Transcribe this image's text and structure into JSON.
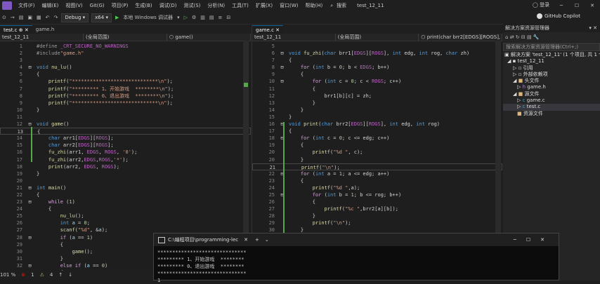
{
  "menubar": {
    "items": [
      "文件(F)",
      "编辑(E)",
      "视图(V)",
      "Git(G)",
      "项目(P)",
      "生成(B)",
      "调试(D)",
      "测试(S)",
      "分析(N)",
      "工具(T)",
      "扩展(X)",
      "窗口(W)",
      "帮助(H)"
    ],
    "search_label": "搜索",
    "window_title": "test_12_11",
    "login_label": "登录"
  },
  "toolbar": {
    "config": "Debug",
    "platform": "x64",
    "run_label": "本地 Windows 调试器",
    "copilot_label": "GitHub Copilot"
  },
  "left_editor": {
    "tabs": [
      "test.c",
      "game.h"
    ],
    "nav_project": "test_12_11",
    "nav_scope": "(全局范围)",
    "nav_function": "game()",
    "zoom": "101 %",
    "status_errors": "1",
    "status_warnings": "4"
  },
  "right_editor": {
    "tabs": [
      "game.c"
    ],
    "nav_project": "test_12_11",
    "nav_scope": "(全局范围)",
    "nav_function": "print(char brr2[EDGS][ROGS], int e"
  },
  "solution_explorer": {
    "header": "解决方案资源管理器",
    "search_placeholder": "搜索解决方案资源管理器(Ctrl+;)",
    "tree": [
      {
        "label": "解决方案 'test_12_11' (1 个项目, 共 1 个)",
        "indent": 0
      },
      {
        "label": "test_12_11",
        "indent": 1
      },
      {
        "label": "引用",
        "indent": 2
      },
      {
        "label": "外部依赖项",
        "indent": 2
      },
      {
        "label": "头文件",
        "indent": 2
      },
      {
        "label": "game.h",
        "indent": 3
      },
      {
        "label": "源文件",
        "indent": 2
      },
      {
        "label": "game.c",
        "indent": 3
      },
      {
        "label": "test.c",
        "indent": 3
      },
      {
        "label": "资源文件",
        "indent": 2
      }
    ]
  },
  "console": {
    "title": "C:\\编程项目\\programming-lec",
    "lines": [
      "******************************",
      "********* 1、开始游戏  ********",
      "********* 0、退出游戏  ********",
      "******************************",
      "1"
    ]
  }
}
